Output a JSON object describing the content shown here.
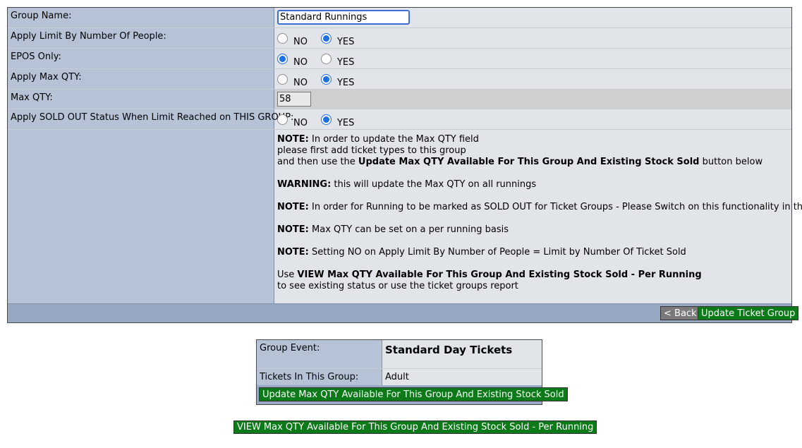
{
  "form": {
    "group_name_label": "Group Name:",
    "group_name_value": "Standard Runnings",
    "apply_limit_label": "Apply Limit By Number Of People:",
    "epos_only_label": "EPOS Only:",
    "apply_max_qty_label": "Apply Max QTY:",
    "max_qty_label": "Max QTY:",
    "max_qty_value": "58",
    "apply_sold_out_label": "Apply SOLD OUT Status When Limit Reached on THIS GROUP:",
    "no_label": "NO",
    "yes_label": "YES",
    "selections": {
      "apply_limit": "YES",
      "epos_only": "NO",
      "apply_max_qty": "YES",
      "apply_sold_out": "YES"
    }
  },
  "notes": {
    "n1_bold": "NOTE:",
    "n1_line1": " In order to update the Max QTY field",
    "n1_line2": "please first add ticket types to this group",
    "n1_line3_pre": "and then use the ",
    "n1_line3_bold": "Update Max QTY Available For This Group And Existing Stock Sold",
    "n1_line3_post": " button below",
    "warning_bold": "WARNING:",
    "warning_text": " this will update the Max QTY on all runnings",
    "n2_bold": "NOTE:",
    "n2_text": " In order for Running to be marked as SOLD OUT for Ticket Groups - Please Switch on this functionality in the event",
    "n3_bold": "NOTE:",
    "n3_text": " Max QTY can be set on a per running basis",
    "n4_bold": "NOTE:",
    "n4_text": " Setting NO on Apply Limit By Number of People = Limit by Number Of Ticket Sold",
    "use_pre": "Use ",
    "use_bold": "VIEW Max QTY Available For This Group And Existing Stock Sold - Per Running",
    "use_line2": "to see existing status or use the ticket groups report"
  },
  "buttons": {
    "back": "< Back",
    "update_group": "Update Ticket Group",
    "update_max_qty": "Update Max QTY Available For This Group And Existing Stock Sold",
    "view_max_qty": "VIEW Max QTY Available For This Group And Existing Stock Sold - Per Running"
  },
  "group_info": {
    "event_label": "Group Event:",
    "event_value": "Standard Day Tickets",
    "tickets_label": "Tickets In This Group:",
    "tickets_value": "Adult"
  },
  "colors": {
    "label_bg": "#b6c3d7",
    "value_bg": "#e1e4e9",
    "footer_bg": "#97a9c2",
    "green_button": "#0d7a1a",
    "back_button": "#7a7a7a",
    "radio_selected": "#1f6fe5"
  }
}
